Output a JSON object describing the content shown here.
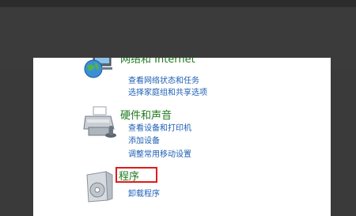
{
  "categories": [
    {
      "title": "网络和 Internet",
      "icon": "network-globe-icon",
      "links": [
        "查看网络状态和任务",
        "选择家庭组和共享选项"
      ]
    },
    {
      "title": "硬件和声音",
      "icon": "printer-icon",
      "links": [
        "查看设备和打印机",
        "添加设备",
        "调整常用移动设置"
      ]
    },
    {
      "title": "程序",
      "icon": "programs-box-icon",
      "links": [
        "卸载程序"
      ]
    }
  ],
  "highlight_color": "#e01b1b",
  "title_color": "#1f7a1f",
  "link_color": "#1e5fb4"
}
